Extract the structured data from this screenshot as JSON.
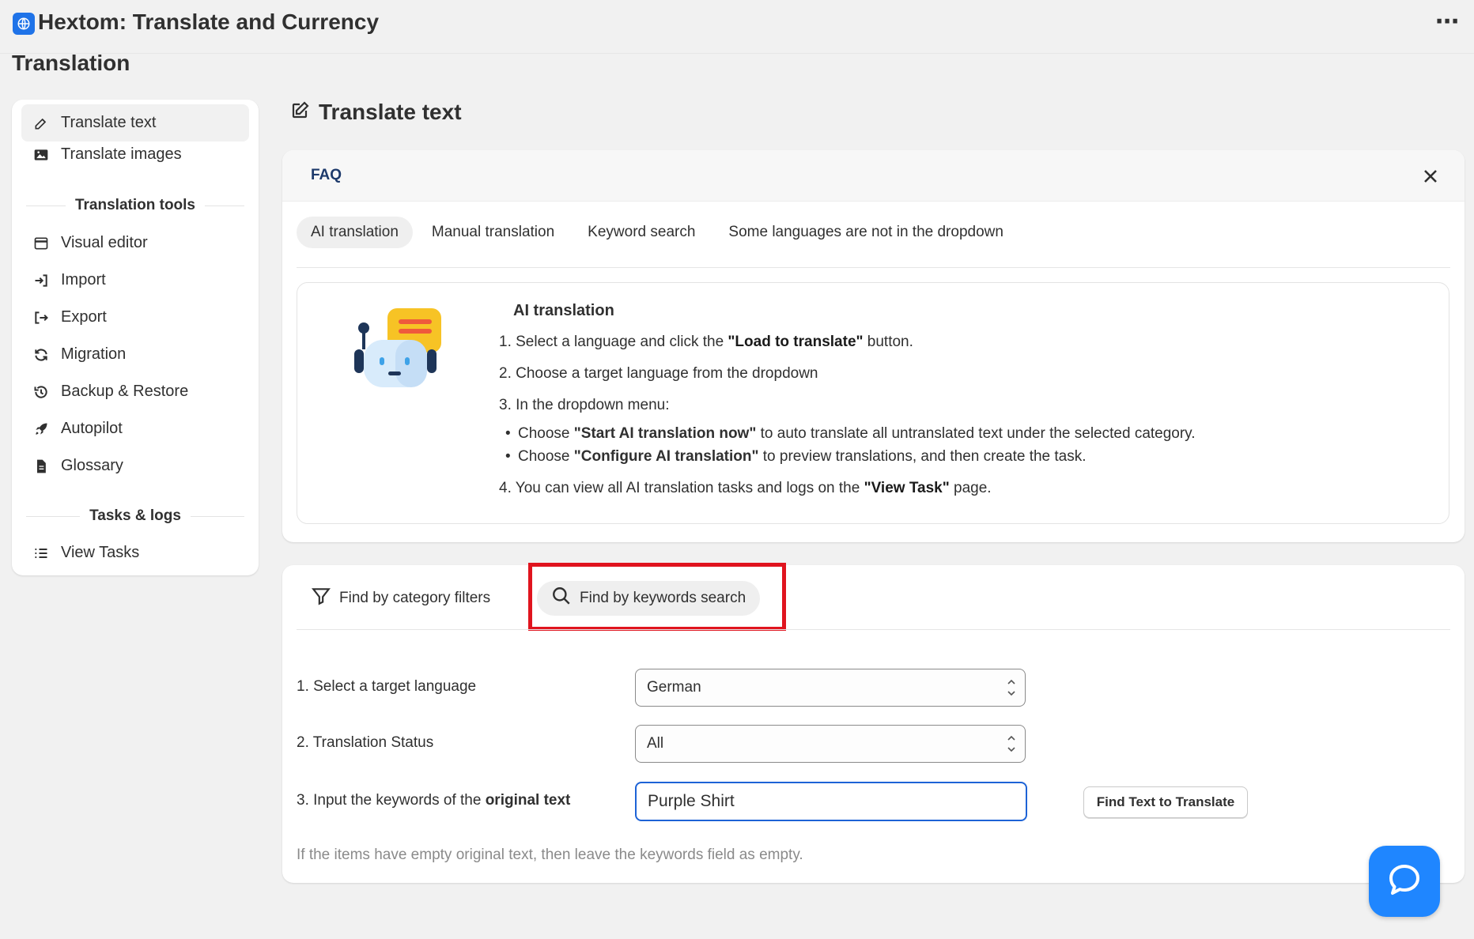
{
  "app": {
    "title": "Hextom: Translate and Currency",
    "icon": "globe-icon",
    "more_label": "⋯"
  },
  "page": {
    "title": "Translation"
  },
  "sidebar": {
    "items": [
      {
        "label": "Translate text",
        "icon": "edit-icon",
        "active": true
      },
      {
        "label": "Translate images",
        "icon": "image-icon"
      }
    ],
    "section_tools": "Translation tools",
    "tools": [
      {
        "label": "Visual editor",
        "icon": "browser-window-icon"
      },
      {
        "label": "Import",
        "icon": "import-icon"
      },
      {
        "label": "Export",
        "icon": "export-icon"
      },
      {
        "label": "Migration",
        "icon": "refresh-icon"
      },
      {
        "label": "Backup & Restore",
        "icon": "history-icon"
      },
      {
        "label": "Autopilot",
        "icon": "rocket-icon"
      },
      {
        "label": "Glossary",
        "icon": "document-icon"
      }
    ],
    "section_tasks": "Tasks & logs",
    "tasks": [
      {
        "label": "View Tasks",
        "icon": "list-icon"
      }
    ]
  },
  "main": {
    "title": "Translate text"
  },
  "faq": {
    "label": "FAQ",
    "tabs": [
      "AI translation",
      "Manual translation",
      "Keyword search",
      "Some languages are not in the dropdown"
    ],
    "active_tab": "AI translation",
    "content": {
      "title": "AI translation",
      "step1_pre": "1. Select a language and click the ",
      "step1_bold": "\"Load to translate\"",
      "step1_post": " button.",
      "step2": "2. Choose a target language from the dropdown",
      "step3": "3. In the dropdown menu:",
      "bullet1_pre": "Choose ",
      "bullet1_bold": "\"Start AI translation now\"",
      "bullet1_post": " to auto translate all untranslated text under the selected category.",
      "bullet2_pre": "Choose ",
      "bullet2_bold": "\"Configure AI translation\"",
      "bullet2_post": " to preview translations, and then create the task.",
      "step4_pre": "4. You can view all AI translation tasks and logs on the ",
      "step4_bold": "\"View Task\"",
      "step4_post": " page."
    }
  },
  "search": {
    "mode_category": "Find by category filters",
    "mode_keywords": "Find by keywords search",
    "active_mode": "keywords",
    "row1_label": "1. Select a target language",
    "row1_value": "German",
    "row2_label": "2. Translation Status",
    "row2_value": "All",
    "row3_label_pre": "3. Input the keywords of the ",
    "row3_label_bold": "original text",
    "keywords_value": "Purple Shirt",
    "find_button": "Find Text to Translate",
    "help": "If the items have empty original text, then leave the keywords field as empty."
  },
  "colors": {
    "accent": "#1f86ff",
    "highlight": "#e0141e",
    "focus": "#1d63d6"
  }
}
